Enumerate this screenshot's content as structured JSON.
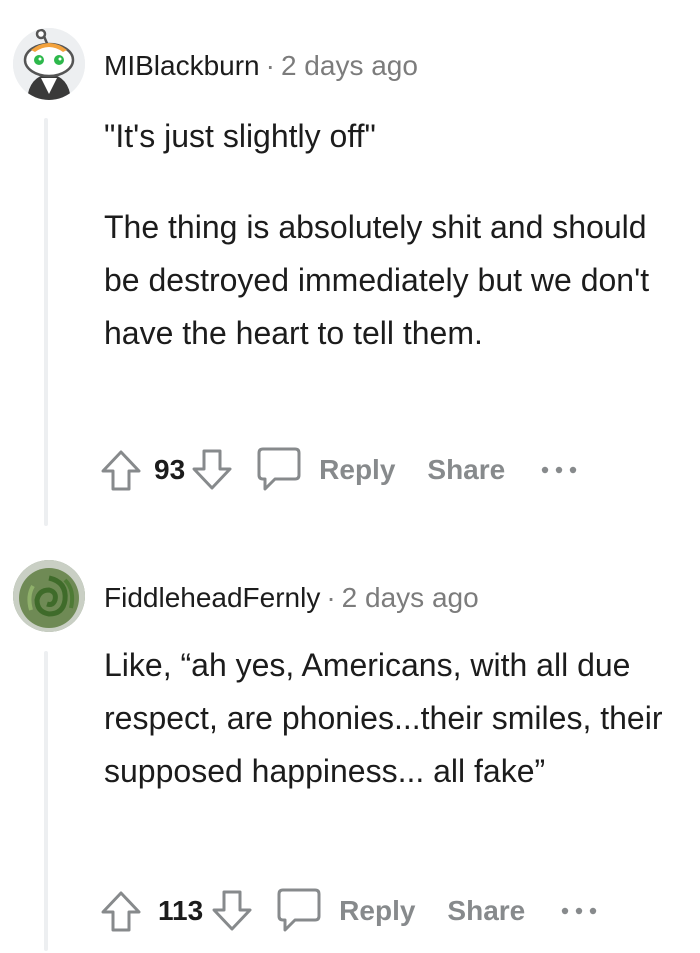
{
  "comments": [
    {
      "username": "MIBlackburn",
      "separator": "·",
      "time": "2 days ago",
      "paragraphs": [
        "\"It's just slightly off\"",
        "The thing is absolutely shit and should be destroyed immediately but we don't have the heart to tell them."
      ],
      "score": "93",
      "reply_label": "Reply",
      "share_label": "Share"
    },
    {
      "username": "FiddleheadFernly",
      "separator": "·",
      "time": "2 days ago",
      "paragraphs": [
        "Like, “ah yes, Americans, with all due respect, are phonies...their smiles, their supposed happiness... all fake”"
      ],
      "score": "113",
      "reply_label": "Reply",
      "share_label": "Share"
    }
  ],
  "icons": {
    "upvote": "arrow-up-icon",
    "downvote": "arrow-down-icon",
    "comment": "speech-bubble-icon",
    "more": "ellipsis-icon"
  },
  "colors": {
    "text": "#1c1c1c",
    "meta": "#7c7c7c",
    "action": "#878a8c",
    "threadline": "#edeff1"
  }
}
